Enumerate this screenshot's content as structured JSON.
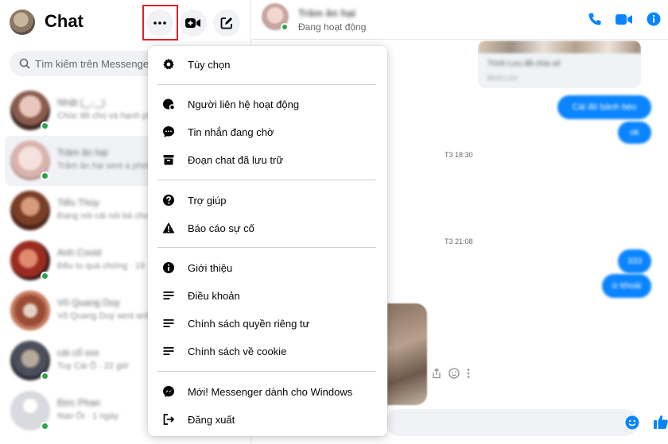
{
  "sidebar": {
    "title": "Chat",
    "search_placeholder": "Tìm kiếm trên Messenger",
    "conversations": [
      {
        "name": "Nhật (‿-‿)",
        "snippet": "Chúc tết chú và hạnh phúc"
      },
      {
        "name": "Trâm ăn hại",
        "snippet": "Trâm ăn hại sent a photo"
      },
      {
        "name": "Tiểu Thúy",
        "snippet": "Đang nói cái nói bá cho"
      },
      {
        "name": "Anh Covid",
        "snippet": "Đều tu quá chứng · 19"
      },
      {
        "name": "Võ Quang Duy",
        "snippet": "Võ Quang Duy sent anh"
      },
      {
        "name": "cái cổ xxx",
        "snippet": "Tuy Cái Ổ · 22 giờ"
      },
      {
        "name": "Đức Phan",
        "snippet": "Nao Ôi · 1 ngày"
      }
    ]
  },
  "chat_header": {
    "name": "Trâm ăn hại",
    "status": "Đang hoạt động"
  },
  "messages": {
    "image_caption": "Trình Lưu đã chia sẻ",
    "image_sub": "Đình Lưu",
    "outgoing_1": "Cái đó bánh bèo",
    "outgoing_2": "ok",
    "time_1": "T3 18:30",
    "time_2": "T3 21:08",
    "outgoing_3": "333",
    "outgoing_4": "ừ khoái"
  },
  "menu": {
    "items": [
      {
        "label": "Tùy chọn",
        "icon": "gear-icon"
      },
      {
        "label": "Người liên hệ hoạt động",
        "icon": "active-contacts-icon"
      },
      {
        "label": "Tin nhắn đang chờ",
        "icon": "chat-bubble-icon"
      },
      {
        "label": "Đoạn chat đã lưu trữ",
        "icon": "archive-icon"
      },
      {
        "label": "Trợ giúp",
        "icon": "help-icon"
      },
      {
        "label": "Báo cáo sự cố",
        "icon": "warning-icon"
      },
      {
        "label": "Giới thiệu",
        "icon": "info-icon"
      },
      {
        "label": "Điều khoản",
        "icon": "lines-icon"
      },
      {
        "label": "Chính sách quyền riêng tư",
        "icon": "lines-icon"
      },
      {
        "label": "Chính sách về cookie",
        "icon": "lines-icon"
      },
      {
        "label": "Mới! Messenger dành cho Windows",
        "icon": "messenger-icon"
      },
      {
        "label": "Đăng xuất",
        "icon": "logout-icon"
      }
    ]
  },
  "colors": {
    "accent": "#0a84ff",
    "online": "#31a24c",
    "highlight": "#e0212b"
  }
}
